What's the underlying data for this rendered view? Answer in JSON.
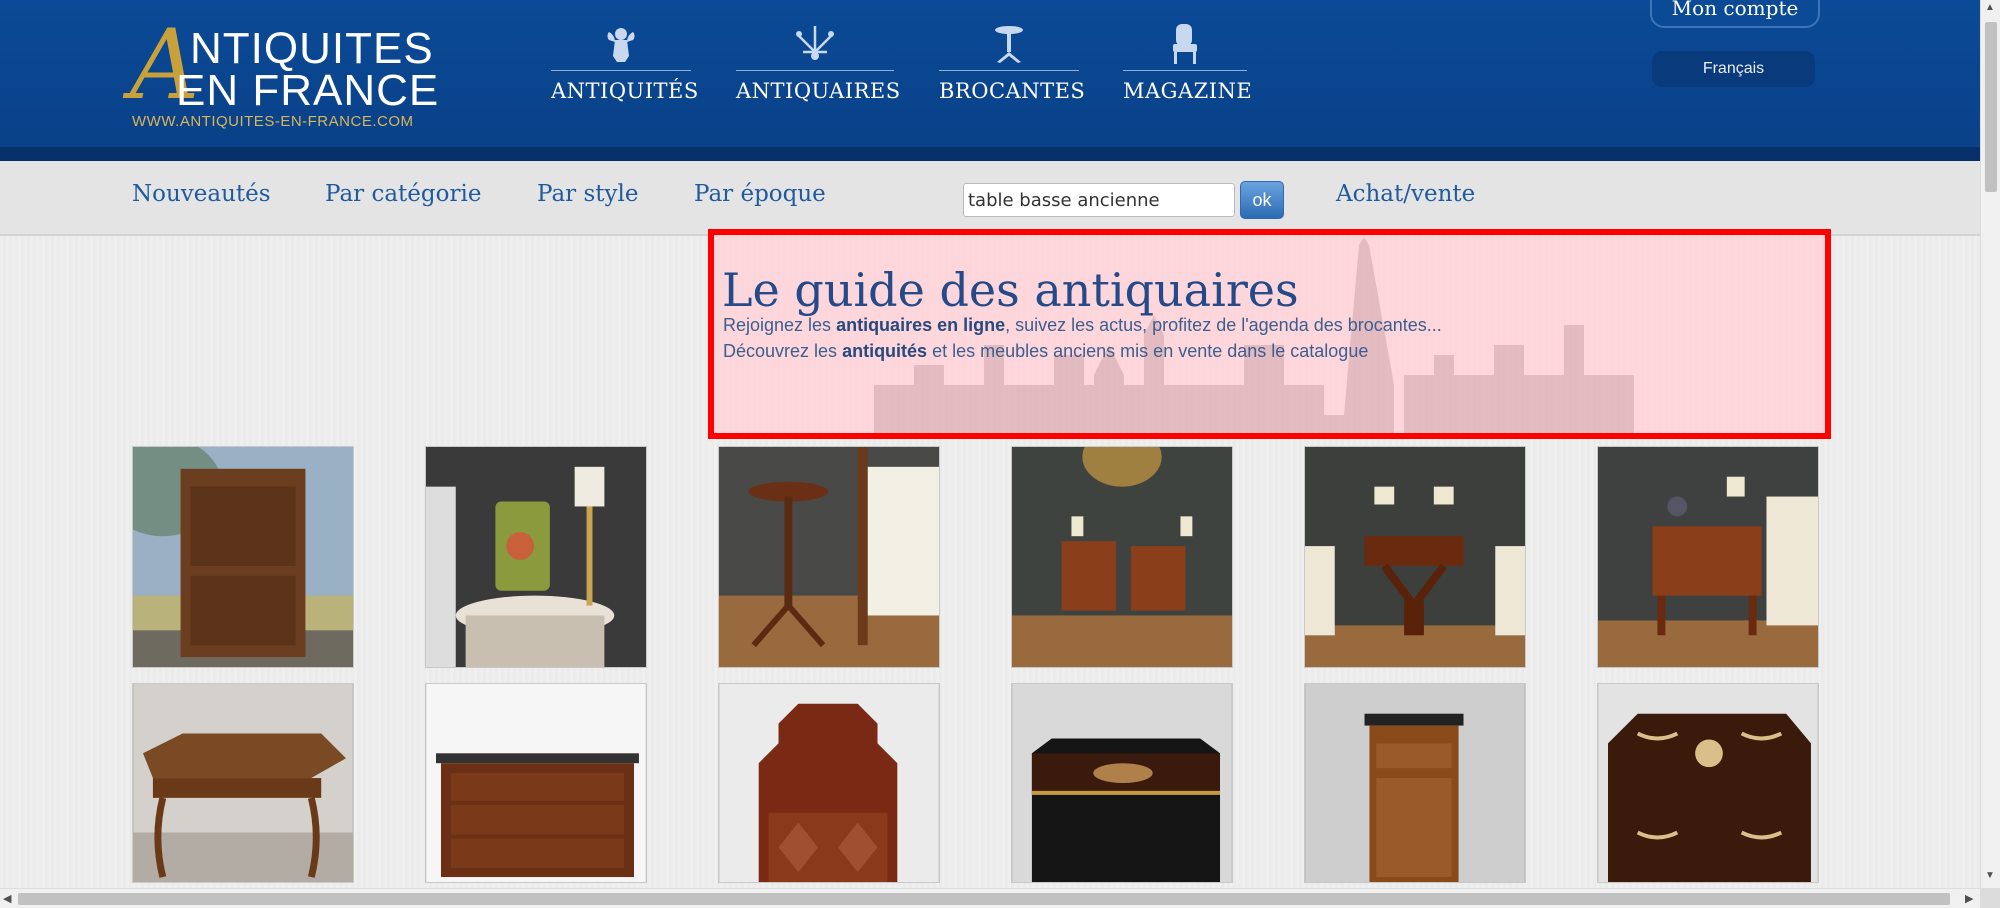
{
  "header": {
    "logo": {
      "line1": "NTIQUITES",
      "line2": "EN FRANCE",
      "letter": "A",
      "url": "WWW.ANTIQUITES-EN-FRANCE.COM"
    },
    "nav": [
      {
        "label": "ANTIQUITÉS",
        "icon": "cherub-icon"
      },
      {
        "label": "ANTIQUAIRES",
        "icon": "chandelier-icon"
      },
      {
        "label": "BROCANTES",
        "icon": "pedestal-table-icon"
      },
      {
        "label": "MAGAZINE",
        "icon": "armchair-icon"
      }
    ],
    "account_label": "Mon compte",
    "language": "Français"
  },
  "subnav": {
    "items": [
      "Nouveautés",
      "Par catégorie",
      "Par style",
      "Par époque"
    ],
    "search_value": "table basse ancienne",
    "search_button": "ok",
    "achat_vente": "Achat/vente"
  },
  "banner": {
    "title": "Le guide des antiquaires",
    "line1": {
      "pre": "Rejoignez les ",
      "bold": "antiquaires en ligne",
      "post": ", suivez les actus, profitez de l'agenda des brocantes..."
    },
    "line2": {
      "pre": "Découvrez les ",
      "bold": "antiquités",
      "post": " et les meubles anciens mis en vente dans le catalogue"
    }
  },
  "products": [
    {
      "name": "armoire-antique",
      "bg": "#8fa8b8"
    },
    {
      "name": "gueridon-lamp",
      "bg": "#3c3c3c"
    },
    {
      "name": "pedestal-table",
      "bg": "#4a4a48"
    },
    {
      "name": "pair-nightstands",
      "bg": "#3f423f"
    },
    {
      "name": "writing-table",
      "bg": "#3d3f3d"
    },
    {
      "name": "side-table",
      "bg": "#3e413f"
    },
    {
      "name": "farm-table",
      "bg": "#c9c6c2"
    },
    {
      "name": "commode",
      "bg": "#f5f5f5"
    },
    {
      "name": "corner-cabinet",
      "bg": "#e8e8e8"
    },
    {
      "name": "boulle-box",
      "bg": "#d8d8d8"
    },
    {
      "name": "pedestal-cabinet",
      "bg": "#d0cfcf"
    },
    {
      "name": "inlaid-box",
      "bg": "#e3e3e3"
    }
  ]
}
